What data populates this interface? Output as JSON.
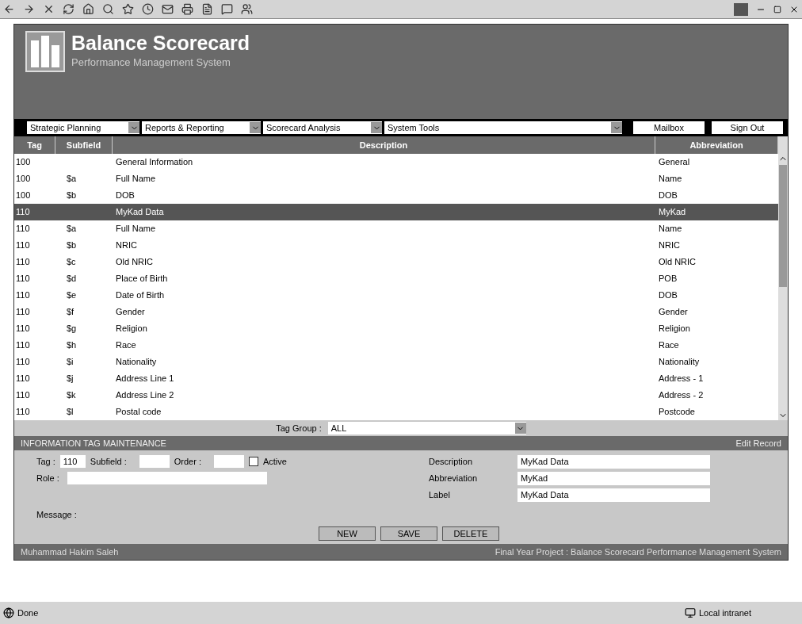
{
  "app": {
    "title": "Balance Scorecard",
    "subtitle": "Performance Management System"
  },
  "menus": [
    {
      "label": "Strategic Planning"
    },
    {
      "label": "Reports & Reporting"
    },
    {
      "label": "Scorecard Analysis"
    },
    {
      "label": "System Tools"
    }
  ],
  "actions": [
    "Mailbox",
    "Sign Out"
  ],
  "table": {
    "columns": [
      "Tag",
      "Subfield",
      "Description",
      "Abbreviation"
    ],
    "rows": [
      {
        "tag": "100",
        "subfield": "",
        "description": "General Information",
        "abbreviation": "General",
        "selected": false
      },
      {
        "tag": "100",
        "subfield": "$a",
        "description": "Full Name",
        "abbreviation": "Name",
        "selected": false
      },
      {
        "tag": "100",
        "subfield": "$b",
        "description": "DOB",
        "abbreviation": "DOB",
        "selected": false
      },
      {
        "tag": "110",
        "subfield": "",
        "description": "MyKad Data",
        "abbreviation": "MyKad",
        "selected": true
      },
      {
        "tag": "110",
        "subfield": "$a",
        "description": "Full Name",
        "abbreviation": "Name",
        "selected": false
      },
      {
        "tag": "110",
        "subfield": "$b",
        "description": "NRIC",
        "abbreviation": "NRIC",
        "selected": false
      },
      {
        "tag": "110",
        "subfield": "$c",
        "description": "Old NRIC",
        "abbreviation": "Old NRIC",
        "selected": false
      },
      {
        "tag": "110",
        "subfield": "$d",
        "description": "Place of Birth",
        "abbreviation": "POB",
        "selected": false
      },
      {
        "tag": "110",
        "subfield": "$e",
        "description": "Date of Birth",
        "abbreviation": "DOB",
        "selected": false
      },
      {
        "tag": "110",
        "subfield": "$f",
        "description": "Gender",
        "abbreviation": "Gender",
        "selected": false
      },
      {
        "tag": "110",
        "subfield": "$g",
        "description": "Religion",
        "abbreviation": "Religion",
        "selected": false
      },
      {
        "tag": "110",
        "subfield": "$h",
        "description": "Race",
        "abbreviation": "Race",
        "selected": false
      },
      {
        "tag": "110",
        "subfield": "$i",
        "description": "Nationality",
        "abbreviation": "Nationality",
        "selected": false
      },
      {
        "tag": "110",
        "subfield": "$j",
        "description": "Address Line 1",
        "abbreviation": "Address - 1",
        "selected": false
      },
      {
        "tag": "110",
        "subfield": "$k",
        "description": "Address Line 2",
        "abbreviation": "Address - 2",
        "selected": false
      },
      {
        "tag": "110",
        "subfield": "$l",
        "description": "Postal code",
        "abbreviation": "Postcode",
        "selected": false
      }
    ]
  },
  "tag_group": {
    "label": "Tag Group :",
    "value": "ALL"
  },
  "section": {
    "title": "INFORMATION TAG MAINTENANCE",
    "mode": "Edit Record"
  },
  "form": {
    "tag": {
      "label": "Tag :",
      "value": "110"
    },
    "subfield": {
      "label": "Subfield :"
    },
    "order": {
      "label": "Order :"
    },
    "active": {
      "label": "Active",
      "checked": false
    },
    "role": {
      "label": "Role :"
    },
    "description": {
      "label": "Description",
      "value": "MyKad Data"
    },
    "abbreviation": {
      "label": "Abbreviation",
      "value": "MyKad"
    },
    "label": {
      "label": "Label",
      "value": "MyKad Data"
    },
    "message": {
      "label": "Message :"
    }
  },
  "buttons": [
    "NEW",
    "SAVE",
    "DELETE"
  ],
  "footer": {
    "author": "Muhammad Hakim Saleh",
    "project": "Final Year Project : Balance Scorecard Performance Management System"
  },
  "status_bar": {
    "status": "Done",
    "zone": "Local intranet"
  }
}
